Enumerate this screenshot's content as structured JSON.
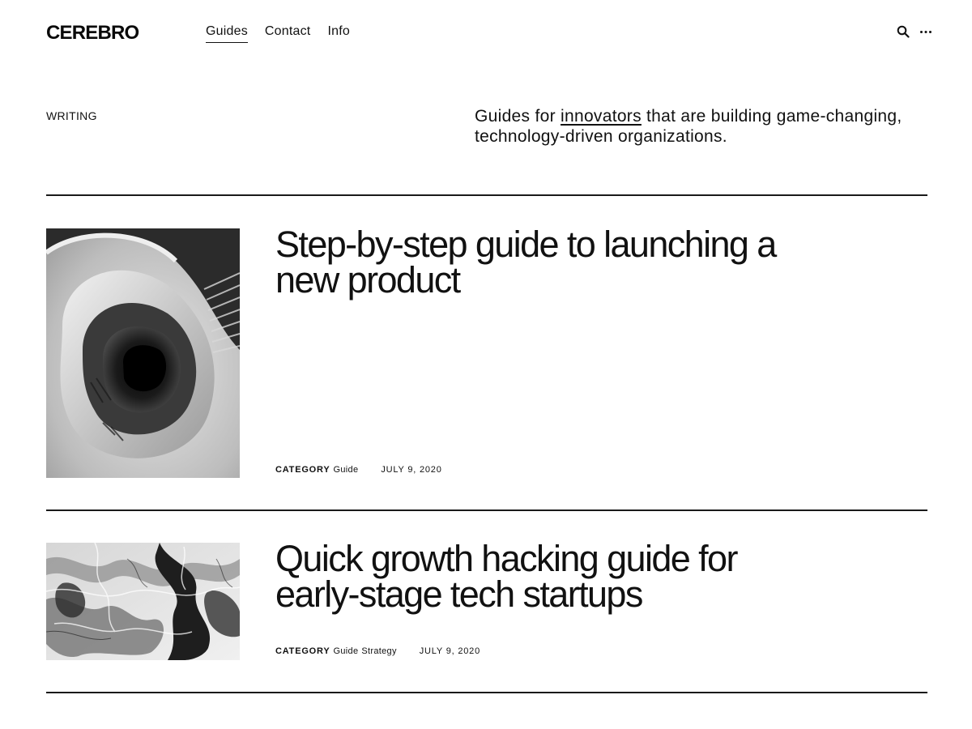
{
  "header": {
    "logo": "CEREBRO",
    "nav": [
      {
        "label": "Guides",
        "active": true
      },
      {
        "label": "Contact",
        "active": false
      },
      {
        "label": "Info",
        "active": false
      }
    ],
    "icons": [
      "search-icon",
      "more-icon"
    ]
  },
  "intro": {
    "label": "WRITING",
    "text_before": "Guides for ",
    "link_text": "innovators",
    "text_after": " that are building game-changing, technology-driven organizations."
  },
  "posts": [
    {
      "title": "Step-by-step guide to launching a new product",
      "category_label": "CATEGORY",
      "categories": [
        "Guide"
      ],
      "date": "JULY 9, 2020",
      "image": "spiral-staircase-photo"
    },
    {
      "title": "Quick growth hacking guide for early-stage tech startups",
      "category_label": "CATEGORY",
      "categories": [
        "Guide",
        "Strategy"
      ],
      "date": "JULY 9, 2020",
      "image": "marbled-ink-photo"
    }
  ],
  "colors": {
    "text": "#111111",
    "background": "#ffffff",
    "rule": "#1a1a1a"
  }
}
